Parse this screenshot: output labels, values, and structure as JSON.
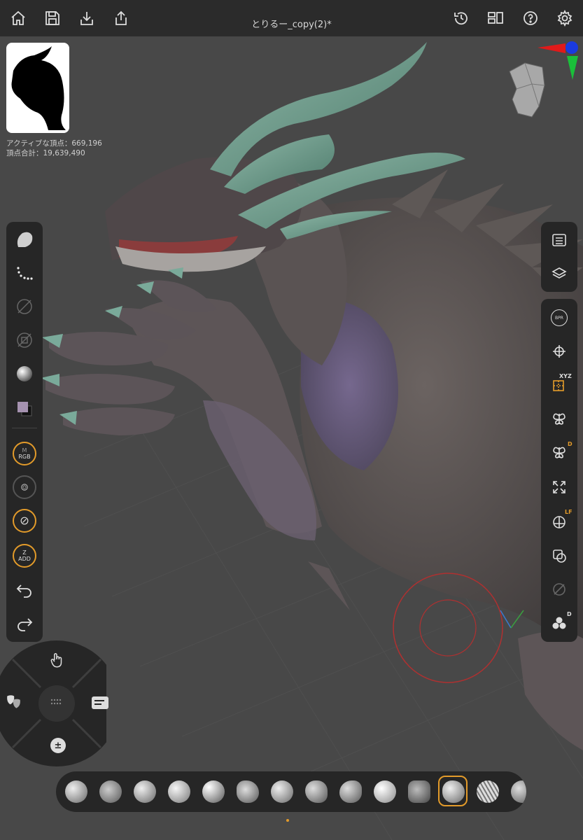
{
  "toolbar": {
    "title": "とりるー_copy(2)*",
    "icons": [
      "home-icon",
      "save-icon",
      "import-icon",
      "export-icon",
      "history-icon",
      "layout-icon",
      "help-icon",
      "settings-icon"
    ]
  },
  "stats": {
    "active_vertices": "アクティブな頂点：669,196",
    "total_vertices": "頂点合計：19,639,490"
  },
  "left_tools": {
    "rgb_top": "M",
    "rgb_bottom": "RGB",
    "zadd_top": "Z",
    "zadd_bottom": "ADD",
    "color_swatch": "#a592b0"
  },
  "right_tools": {
    "bpr": "BPR",
    "xyz": "XYZ",
    "dynamic_badge": "D",
    "lf_badge": "LF",
    "solo_badge": "D"
  },
  "gestures": {
    "plus_minus": "±"
  },
  "colors": {
    "accent": "#e39b2a",
    "panel": "#262626",
    "topbar": "#2b2b2b",
    "background": "#484848"
  },
  "brushes": [
    "clay-buildup",
    "standard",
    "damstandard",
    "inflate",
    "smooth",
    "move",
    "snakehook",
    "pinch",
    "trim",
    "sphere",
    "chisel",
    "clay",
    "dam-tubes",
    "orb"
  ]
}
